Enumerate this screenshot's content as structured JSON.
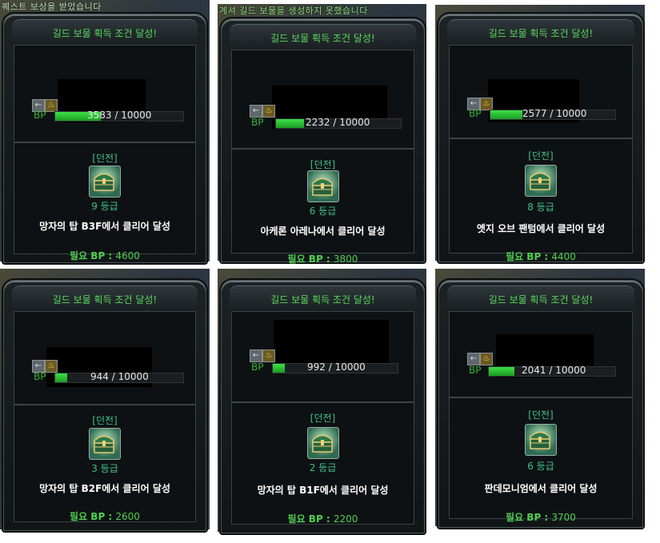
{
  "notices": {
    "a": "퀘스트 보상을 받았습니다",
    "b": "계셔 길드 보물을 생성하지 못했습니다"
  },
  "panel_title": "길드 보물 획득 조건 달성!",
  "bp_label": "BP",
  "dungeon_label": "[던전]",
  "required_prefix": "필요 BP : ",
  "panels": [
    {
      "bp_current": 3583,
      "bp_max": 10000,
      "bp_text": "3583 / 10000",
      "grade": "9 등급",
      "condition": "망자의 탑 B3F에서 클리어 달성",
      "required_bp": "4600"
    },
    {
      "bp_current": 2232,
      "bp_max": 10000,
      "bp_text": "2232 / 10000",
      "grade": "6 등급",
      "condition": "아케론 아레나에서 클리어 달성",
      "required_bp": "3800"
    },
    {
      "bp_current": 2577,
      "bp_max": 10000,
      "bp_text": "2577 / 10000",
      "grade": "8 등급",
      "condition": "엣지 오브 팬텀에서 클리어 달성",
      "required_bp": "4400"
    },
    {
      "bp_current": 944,
      "bp_max": 10000,
      "bp_text": "944 / 10000",
      "grade": "3 등급",
      "condition": "망자의 탑 B2F에서 클리어 달성",
      "required_bp": "2600"
    },
    {
      "bp_current": 992,
      "bp_max": 10000,
      "bp_text": "992 / 10000",
      "grade": "2 등급",
      "condition": "망자의 탑 B1F에서 클리어 달성",
      "required_bp": "2200"
    },
    {
      "bp_current": 2041,
      "bp_max": 10000,
      "bp_text": "2041 / 10000",
      "grade": "6 등급",
      "condition": "판데모니엄에서 클리어 달성",
      "required_bp": "3700"
    }
  ],
  "icons": [
    "back-arrow-icon",
    "guild-emblem-icon",
    "treasure-chest-icon"
  ],
  "colors": {
    "title_green": "#59d85c",
    "bar_green": "#2fcf38",
    "grade_teal": "#3fbf8e"
  }
}
